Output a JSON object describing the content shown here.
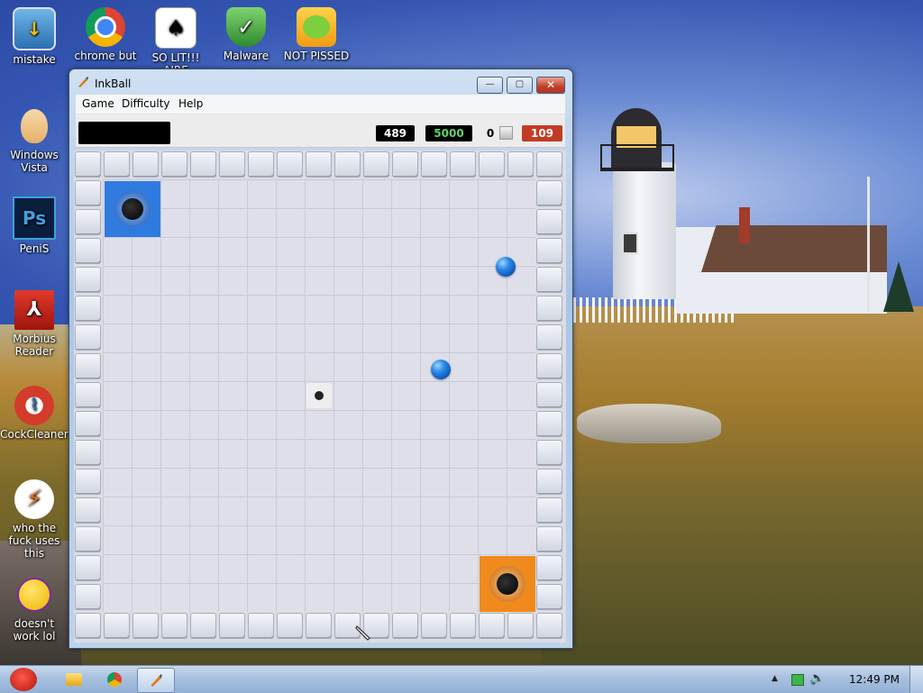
{
  "desktop": {
    "icons": [
      {
        "label": "mistake",
        "icon": "computer-monitor-icon"
      },
      {
        "label": "chrome but",
        "icon": "chrome-icon"
      },
      {
        "label": "SO LIT!!! AIRE",
        "icon": "solitaire-cards-icon"
      },
      {
        "label": "Malware",
        "icon": "shield-check-icon"
      },
      {
        "label": "NOT PISSED",
        "icon": "angry-pig-icon"
      },
      {
        "label": "Windows Vista",
        "icon": "egg-icon"
      },
      {
        "label": "PeniS",
        "icon": "photoshop-icon"
      },
      {
        "label": "Morbius Reader",
        "icon": "pdf-reader-icon"
      },
      {
        "label": "CockCleaner",
        "icon": "broom-cleaner-icon"
      },
      {
        "label": "who the fuck uses this",
        "icon": "lightning-bolt-icon"
      },
      {
        "label": "doesn't work lol",
        "icon": "yahoo-messenger-icon"
      }
    ]
  },
  "window": {
    "title": "InkBall",
    "controls": {
      "minimize": "—",
      "maximize": "▢",
      "close": "✕"
    },
    "menu": [
      "Game",
      "Difficulty",
      "Help"
    ],
    "toolbar": {
      "score": "489",
      "target": "5000",
      "balls": "0",
      "timer": "109"
    },
    "colors": {
      "blue_hole": "#2f7be0",
      "orange_hole": "#f08a1c",
      "ball": "#1f6fd6",
      "timer_bg": "#c33b24",
      "target_text": "#5fd36a"
    }
  },
  "taskbar": {
    "start_icon": "angry-bird-start-icon",
    "pinned": [
      "explorer-folder-icon",
      "chrome-icon",
      "inkball-icon"
    ],
    "clock": "12:49 PM"
  }
}
